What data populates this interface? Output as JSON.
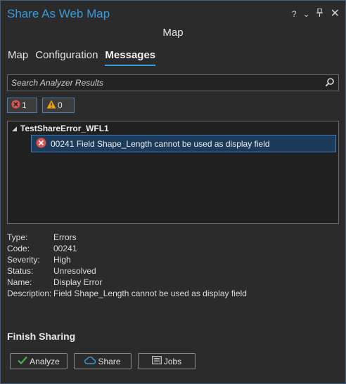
{
  "window": {
    "title": "Share As Web Map",
    "controls": {
      "help": "?",
      "options": "⌄",
      "pin": "⊥",
      "close": "✕"
    }
  },
  "header": {
    "subtitle": "Map"
  },
  "tabs": [
    {
      "label": "Map",
      "active": false
    },
    {
      "label": "Configuration",
      "active": false
    },
    {
      "label": "Messages",
      "active": true
    }
  ],
  "search": {
    "placeholder": "Search Analyzer Results",
    "value": ""
  },
  "filters": {
    "errors_count": "1",
    "warnings_count": "0"
  },
  "results": {
    "root_label": "TestShareError_WFL1",
    "items": [
      {
        "code": "00241",
        "text": "00241 Field Shape_Length cannot be used as display field",
        "selected": true
      }
    ]
  },
  "details": {
    "type_label": "Type:",
    "type_value": "Errors",
    "code_label": "Code:",
    "code_value": "00241",
    "severity_label": "Severity:",
    "severity_value": "High",
    "status_label": "Status:",
    "status_value": "Unresolved",
    "name_label": "Name:",
    "name_value": "Display Error",
    "description_label": "Description:",
    "description_value": "Field Shape_Length cannot be used as display field"
  },
  "finish": {
    "title": "Finish Sharing",
    "analyze_label": "Analyze",
    "share_label": "Share",
    "jobs_label": "Jobs"
  },
  "colors": {
    "accent": "#3a9bdc",
    "error": "#d9534f",
    "warning": "#e8a317",
    "selection": "#1c3b5a",
    "check": "#4caf50"
  },
  "icons": {
    "search": "magnifier-icon",
    "error": "error-icon",
    "warning": "warning-icon",
    "analyze": "checkmark-icon",
    "share": "cloud-icon",
    "jobs": "jobs-list-icon"
  }
}
